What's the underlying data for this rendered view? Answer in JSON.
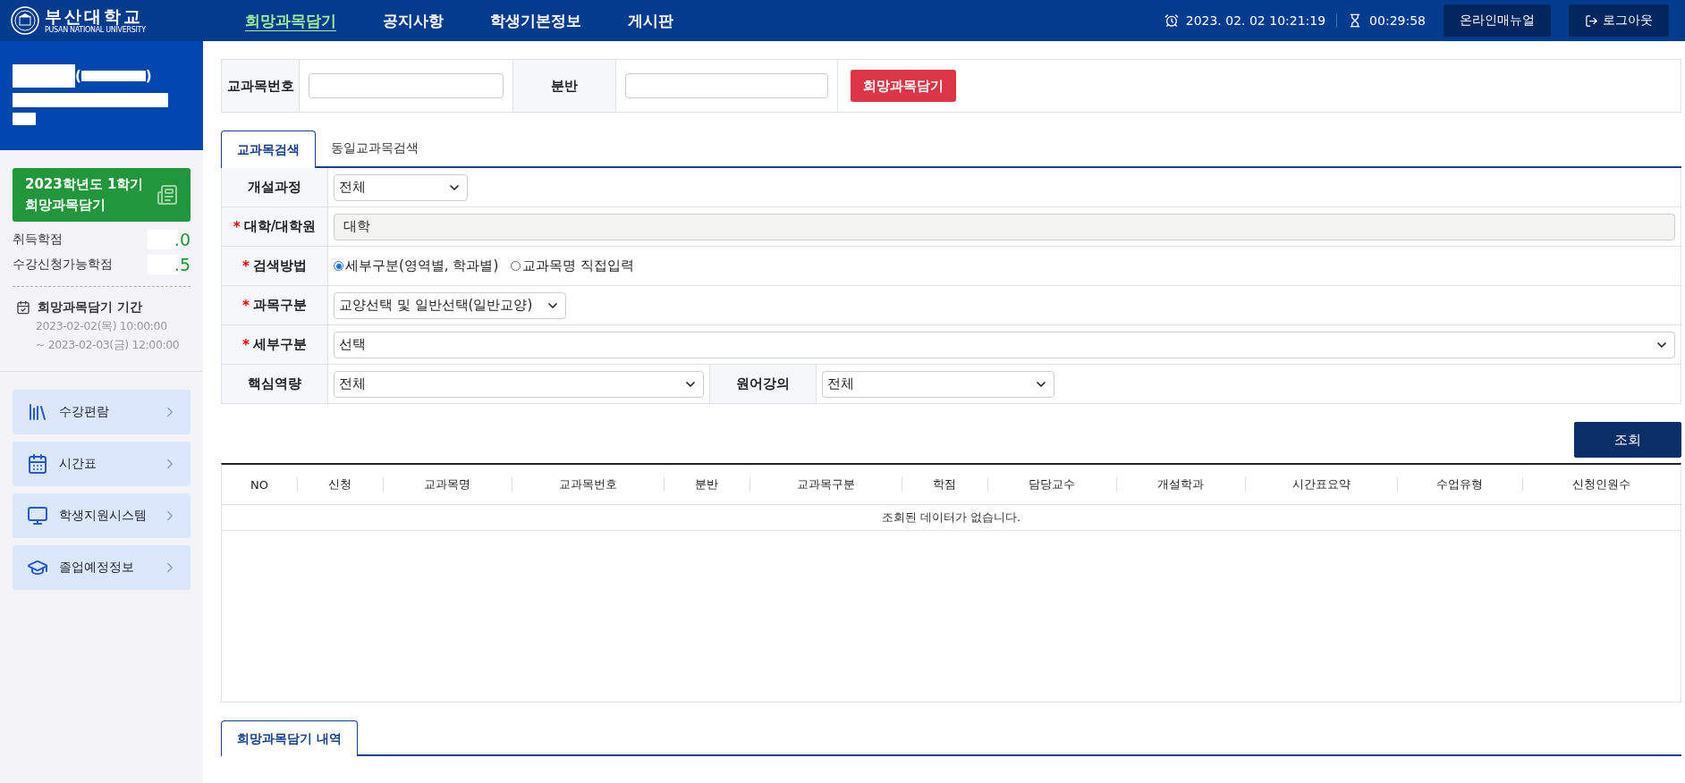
{
  "header": {
    "logo": {
      "name": "부산대학교",
      "subtitle": "PUSAN NATIONAL UNIVERSITY"
    },
    "nav": [
      {
        "label": "희망과목담기",
        "selected": true
      },
      {
        "label": "공지사항",
        "selected": false
      },
      {
        "label": "학생기본정보",
        "selected": false
      },
      {
        "label": "게시판",
        "selected": false
      }
    ],
    "datetime": "2023. 02. 02 10:21:19",
    "timer": "00:29:58",
    "buttons": [
      {
        "label": "온라인매뉴얼",
        "kind": "plain"
      },
      {
        "label": "로그아웃",
        "kind": "logout"
      }
    ]
  },
  "sidebar": {
    "profile": {
      "bracket_open": "(",
      "bracket_close": ")"
    },
    "term_card": {
      "lines": [
        "2023학년도 1학기",
        "희망과목담기"
      ]
    },
    "credits": [
      {
        "label": "취득학점",
        "value": ".0"
      },
      {
        "label": "수강신청가능학점",
        "value": ".5"
      }
    ],
    "period": {
      "title": "희망과목담기 기간",
      "lines": [
        "2023-02-02(목) 10:00:00",
        "~ 2023-02-03(금) 12:00:00"
      ]
    },
    "menu": [
      {
        "label": "수강편람"
      },
      {
        "label": "시간표"
      },
      {
        "label": "학생지원시스템"
      },
      {
        "label": "졸업예정정보"
      }
    ]
  },
  "quick_add": {
    "fields": [
      {
        "label": "교과목번호"
      },
      {
        "label": "분반"
      }
    ],
    "button": "희망과목담기"
  },
  "tabs": [
    {
      "label": "교과목검색",
      "selected": true
    },
    {
      "label": "동일교과목검색",
      "selected": false
    }
  ],
  "search_form": {
    "rows": [
      {
        "cells": [
          {
            "label": "개설과정",
            "kind": "select",
            "value": "전체"
          }
        ]
      },
      {
        "cells": [
          {
            "label": "대학/대학원",
            "required_mark": "*",
            "kind": "readonly",
            "value": "대학"
          }
        ]
      },
      {
        "cells": [
          {
            "label": "검색방법",
            "required_mark": "*",
            "kind": "radio",
            "options": [
              {
                "label": "세부구분(영역별, 학과별)",
                "selected": true
              },
              {
                "label": "교과목명 직접입력",
                "selected": false
              }
            ]
          }
        ]
      },
      {
        "cells": [
          {
            "label": "과목구분",
            "required_mark": "*",
            "kind": "select",
            "value": "교양선택 및 일반선택(일반교양)"
          }
        ]
      },
      {
        "cells": [
          {
            "label": "세부구분",
            "required_mark": "*",
            "kind": "select",
            "value": "선택"
          }
        ]
      },
      {
        "cells": [
          {
            "label": "핵심역량",
            "kind": "select",
            "value": "전체"
          },
          {
            "label": "원어강의",
            "kind": "select",
            "value": "전체"
          }
        ]
      }
    ]
  },
  "query_button": "조회",
  "results": {
    "columns": [
      "NO",
      "신청",
      "교과목명",
      "교과목번호",
      "분반",
      "교과목구분",
      "학점",
      "담당교수",
      "개설학과",
      "시간표요약",
      "수업유형",
      "신청인원수"
    ],
    "empty_message": "조회된 데이터가 없습니다."
  },
  "bottom_tabs": [
    {
      "label": "희망과목담기 내역",
      "selected": true
    }
  ]
}
